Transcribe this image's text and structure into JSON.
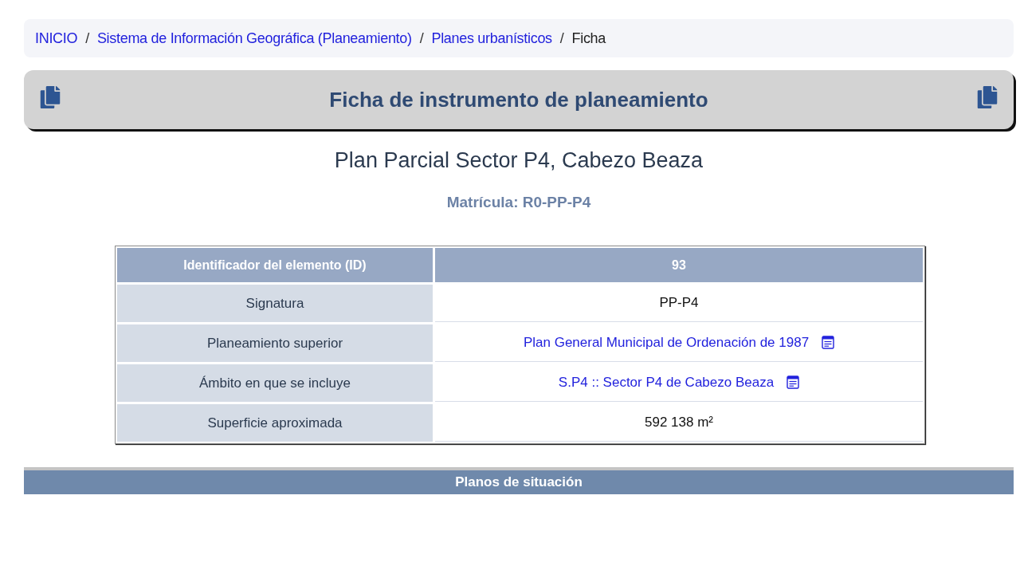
{
  "breadcrumb": [
    {
      "label": "INICIO",
      "kind": "link"
    },
    {
      "label": "/",
      "kind": "separator"
    },
    {
      "label": "Sistema de Información Geográfica (Planeamiento)",
      "kind": "link"
    },
    {
      "label": "/",
      "kind": "separator"
    },
    {
      "label": "Planes urbanísticos",
      "kind": "link"
    },
    {
      "label": "/",
      "kind": "separator"
    },
    {
      "label": "Ficha",
      "kind": "current"
    }
  ],
  "header": {
    "title": "Ficha de instrumento de planeamiento"
  },
  "plan_name": "Plan Parcial Sector P4, Cabezo Beaza",
  "registration": "Matrícula: R0-PP-P4",
  "table": {
    "header": {
      "label": "Identificador del elemento (ID)",
      "value": "93"
    },
    "rows": [
      {
        "label": "Signatura",
        "value": "PP-P4",
        "kind": "text"
      },
      {
        "label": "Planeamiento superior",
        "value": "Plan General Municipal de Ordenación de 1987",
        "kind": "link"
      },
      {
        "label": "Ámbito en que se incluye",
        "value": "S.P4 :: Sector P4 de Cabezo Beaza",
        "kind": "link"
      },
      {
        "label": "Superficie aproximada",
        "value": "592 138 m²",
        "kind": "text"
      }
    ]
  },
  "section": {
    "title": "Planos de situación"
  }
}
